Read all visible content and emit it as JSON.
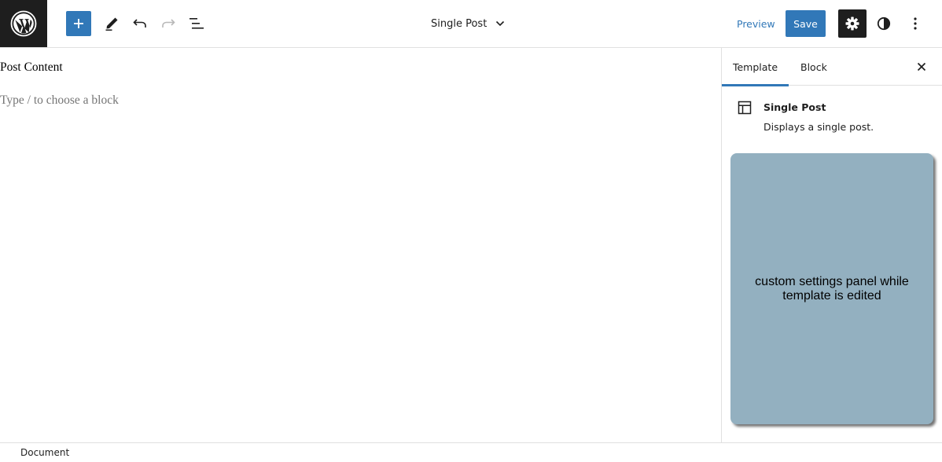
{
  "header": {
    "logo_icon": "wordpress-icon",
    "toolbar": {
      "add_icon": "plus-icon",
      "edit_icon": "pencil-icon",
      "undo_icon": "undo-icon",
      "redo_icon": "redo-icon",
      "list_view_icon": "list-view-icon"
    },
    "document_title": "Single Post",
    "document_title_icon": "chevron-down-icon",
    "preview_label": "Preview",
    "save_label": "Save",
    "settings_icon": "gear-icon",
    "styles_icon": "half-circle-icon",
    "more_icon": "vertical-ellipsis-icon"
  },
  "canvas": {
    "post_content_label": "Post Content",
    "block_placeholder": "Type / to choose a block"
  },
  "sidebar": {
    "tabs": [
      {
        "label": "Template",
        "active": true
      },
      {
        "label": "Block",
        "active": false
      }
    ],
    "close_icon": "close-icon",
    "template": {
      "icon": "layout-icon",
      "name": "Single Post",
      "description": "Displays a single post."
    },
    "custom_panel_text": "custom settings panel while template is edited"
  },
  "footer": {
    "breadcrumb": "Document"
  },
  "colors": {
    "accent": "#3178b8",
    "dark": "#1e1e1e",
    "panel": "#93b0c0",
    "placeholder": "#757575"
  }
}
